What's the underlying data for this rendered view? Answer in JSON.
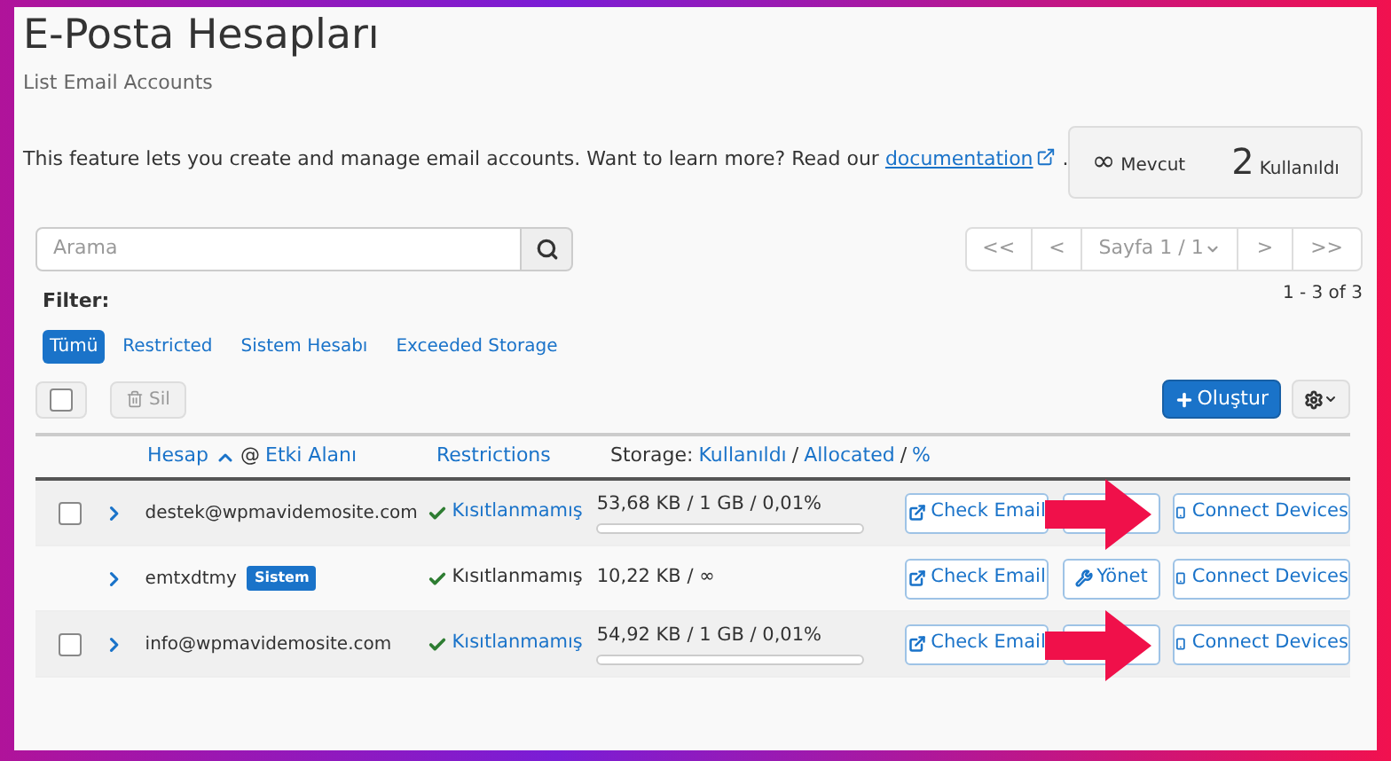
{
  "header": {
    "title": "E-Posta Hesapları",
    "subtitle": "List Email Accounts"
  },
  "intro": {
    "text": "This feature lets you create and manage email accounts. Want to learn more? Read our",
    "link": "documentation",
    "end": "."
  },
  "stats": [
    {
      "value": "∞",
      "label": "Mevcut"
    },
    {
      "value": "2",
      "label": "Kullanıldı"
    }
  ],
  "search": {
    "placeholder": "Arama"
  },
  "pagination": {
    "first": "<<",
    "prev": "<",
    "page": "Sayfa 1 / 1",
    "next": ">",
    "last": ">>",
    "range": "1 - 3 of 3"
  },
  "filter": {
    "label": "Filter:",
    "options": [
      {
        "label": "Tümü",
        "selected": true
      },
      {
        "label": "Restricted",
        "selected": false
      },
      {
        "label": "Sistem Hesabı",
        "selected": false
      },
      {
        "label": "Exceeded Storage",
        "selected": false
      }
    ]
  },
  "toolbar": {
    "select_all": {
      "checked": false
    },
    "delete": "Sil",
    "create": "Oluştur"
  },
  "table": {
    "columns": [
      {
        "parts": [
          {
            "kind": "link",
            "text": "Hesap"
          },
          {
            "kind": "sort"
          },
          {
            "kind": "text",
            "text": "@"
          },
          {
            "kind": "link",
            "text": "Etki Alanı"
          }
        ]
      },
      {
        "parts": [
          {
            "kind": "link",
            "text": "Restrictions"
          }
        ]
      },
      {
        "parts": [
          {
            "kind": "text",
            "text": "Storage:"
          },
          {
            "kind": "link",
            "text": "Kullanıldı"
          },
          {
            "kind": "text",
            "text": "/"
          },
          {
            "kind": "link",
            "text": "Allocated"
          },
          {
            "kind": "text",
            "text": "/"
          },
          {
            "kind": "link",
            "text": "%"
          }
        ]
      }
    ],
    "rows": [
      {
        "checked": false,
        "account": "destek@wpmavidemosite.com",
        "restriction": "Kısıtlanmamış",
        "restriction_link": true,
        "storage": "53,68 KB / 1 GB / 0,01%",
        "level": 0.0001,
        "check": "Check Email",
        "arrow": true,
        "connect": "Connect Devices"
      },
      {
        "account": "emtxdtmy",
        "badge": "Sistem",
        "restriction": "Kısıtlanmamış",
        "restriction_link": false,
        "storage": "10,22 KB / ∞",
        "check": "Check Email",
        "manage": "Yönet",
        "arrow": false,
        "connect": "Connect Devices"
      },
      {
        "checked": false,
        "account": "info@wpmavidemosite.com",
        "restriction": "Kısıtlanmamış",
        "restriction_link": true,
        "storage": "54,92 KB / 1 GB / 0,01%",
        "level": 0.0001,
        "check": "Check Email",
        "arrow": true,
        "connect": "Connect Devices"
      }
    ]
  }
}
